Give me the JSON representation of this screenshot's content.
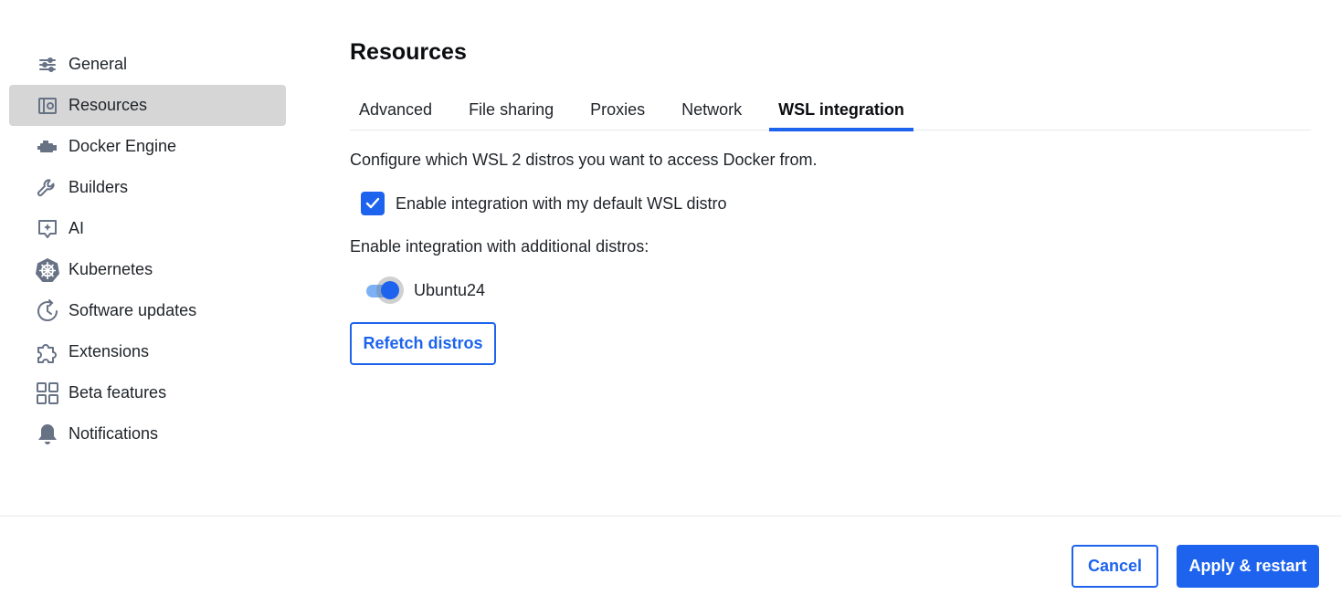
{
  "sidebar": {
    "items": [
      {
        "label": "General",
        "icon": "sliders-icon"
      },
      {
        "label": "Resources",
        "icon": "resources-icon",
        "active": true
      },
      {
        "label": "Docker Engine",
        "icon": "engine-icon"
      },
      {
        "label": "Builders",
        "icon": "wrench-icon"
      },
      {
        "label": "AI",
        "icon": "ai-icon"
      },
      {
        "label": "Kubernetes",
        "icon": "kubernetes-icon"
      },
      {
        "label": "Software updates",
        "icon": "clock-update-icon"
      },
      {
        "label": "Extensions",
        "icon": "puzzle-icon"
      },
      {
        "label": "Beta features",
        "icon": "grid-icon"
      },
      {
        "label": "Notifications",
        "icon": "bell-icon"
      }
    ]
  },
  "main": {
    "title": "Resources",
    "tabs": [
      {
        "label": "Advanced"
      },
      {
        "label": "File sharing"
      },
      {
        "label": "Proxies"
      },
      {
        "label": "Network"
      },
      {
        "label": "WSL integration",
        "active": true
      }
    ],
    "description": "Configure which WSL 2 distros you want to access Docker from.",
    "default_distro": {
      "label": "Enable integration with my default WSL distro",
      "checked": true
    },
    "additional_label": "Enable integration with additional distros:",
    "distros": [
      {
        "name": "Ubuntu24",
        "enabled": true
      }
    ],
    "refetch_label": "Refetch distros"
  },
  "footer": {
    "cancel_label": "Cancel",
    "apply_label": "Apply & restart"
  },
  "colors": {
    "accent": "#1d63ed",
    "active_nav_bg": "#d6d6d6",
    "icon": "#677285"
  }
}
